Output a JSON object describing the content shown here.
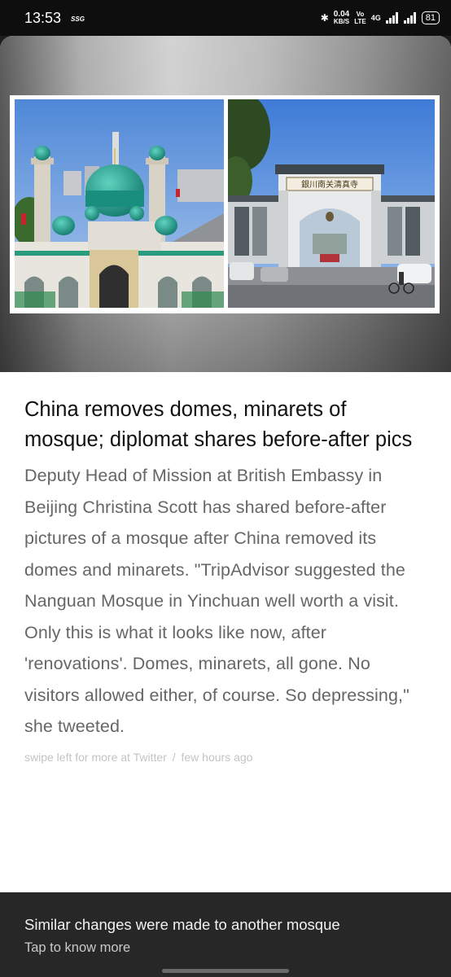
{
  "status_bar": {
    "time": "13:53",
    "carrier_extra": "SSG",
    "speed_value": "0.04",
    "speed_unit": "KB/S",
    "volte_top": "Vo",
    "volte_bottom": "LTE",
    "network": "4G",
    "battery": "81"
  },
  "article": {
    "photo_before_alt": "mosque with green domes and minarets",
    "photo_after_alt": "mosque gate after domes removed",
    "headline": "China removes domes, minarets of mosque; diplomat shares before-after pics",
    "body": "Deputy Head of Mission at British Embassy in Beijing Christina Scott has shared before-after pictures of a mosque after China removed its domes and minarets. \"TripAdvisor suggested the Nanguan Mosque in Yinchuan well worth a visit. Only this is what it looks like now, after 'renovations'. Domes, minarets, all gone. No visitors allowed either, of course. So depressing,\" she tweeted.",
    "swipe_text": "swipe left for more at Twitter",
    "separator": "/",
    "time_ago": "few hours ago"
  },
  "more": {
    "title": "Similar changes were made to another mosque",
    "subtitle": "Tap to know more"
  },
  "colors": {
    "card_bg": "#ffffff",
    "banner_bg": "#272727",
    "dome_green": "#1f9a8a",
    "sky_blue": "#4f88d8"
  }
}
